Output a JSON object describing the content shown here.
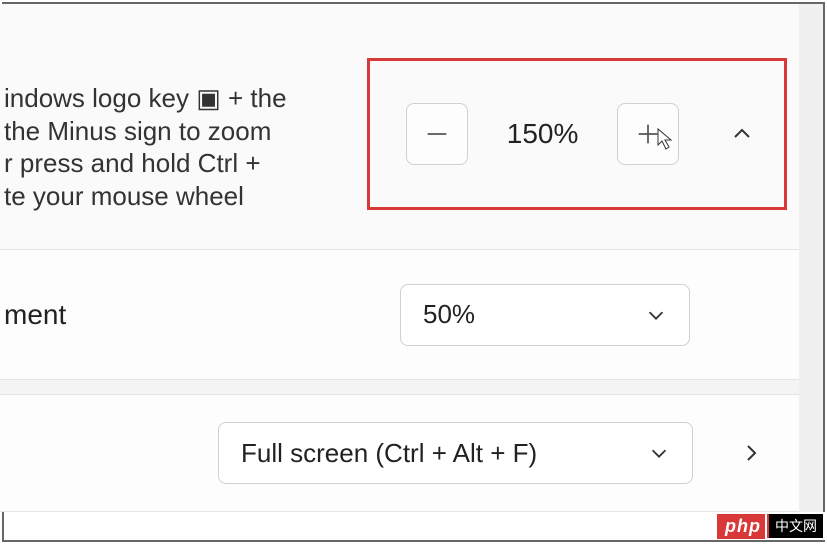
{
  "zoom": {
    "description_line1": "indows logo key ▣ + the",
    "description_line2": " the Minus sign to zoom",
    "description_line3": "r press and hold Ctrl +",
    "description_line4": "te your mouse wheel",
    "value": "150%"
  },
  "increment": {
    "label": "ment",
    "value": "50%"
  },
  "fullscreen": {
    "label": "Full screen (Ctrl + Alt + F)"
  },
  "watermark": {
    "php": "php",
    "cn": "中文网"
  }
}
